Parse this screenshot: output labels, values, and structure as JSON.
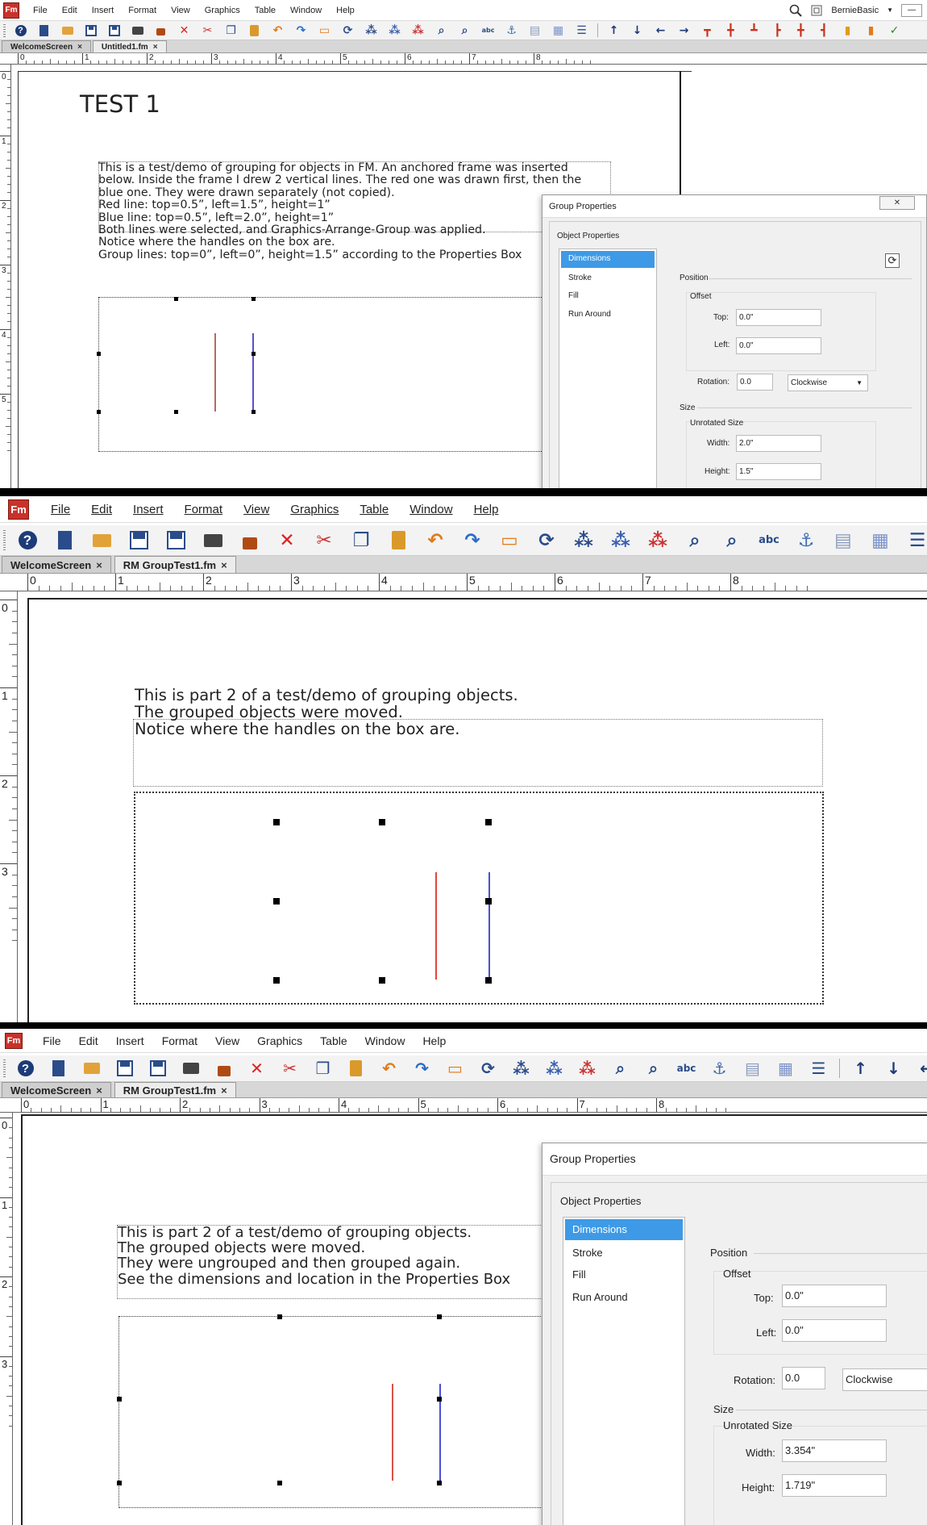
{
  "menu": {
    "logo": "Fm",
    "items": [
      "File",
      "Edit",
      "Insert",
      "Format",
      "View",
      "Graphics",
      "Table",
      "Window",
      "Help"
    ],
    "user": "BernieBasic"
  },
  "toolbar_icons": [
    "help-icon",
    "new-doc-icon",
    "open-icon",
    "save-icon",
    "save-all-icon",
    "print-icon",
    "lock-icon",
    "delete-icon",
    "cut-icon",
    "copy-icon",
    "paste-icon",
    "undo-icon",
    "redo-icon",
    "frame-icon",
    "rotate-icon",
    "group-icon",
    "ungroup-icon",
    "object-icon",
    "zoom-in-icon",
    "zoom-out-icon",
    "spelling-icon",
    "anchor-icon",
    "insert-frame-icon",
    "insert-table-icon",
    "properties-icon",
    "up-arrow-icon",
    "down-arrow-icon",
    "left-arrow-icon",
    "right-arrow-icon",
    "align-top-icon",
    "align-middle-icon",
    "align-bottom-icon",
    "align-left-icon",
    "align-center-icon",
    "align-right-icon",
    "front-icon",
    "back-icon",
    "check-icon"
  ],
  "panel1": {
    "tabs": [
      "WelcomeScreen",
      "Untitled1.fm"
    ],
    "ruler_h": [
      "0",
      "1",
      "2",
      "3",
      "4",
      "5",
      "6",
      "7",
      "8"
    ],
    "ruler_v": [
      "0",
      "1",
      "2",
      "3",
      "4",
      "5"
    ],
    "heading": "TEST 1",
    "lines": [
      "This is a test/demo of grouping for objects in FM. An anchored frame was inserted",
      "below. Inside the frame I drew 2 vertical lines. The red one was drawn first, then the",
      "blue one. They were drawn separately (not copied).",
      "Red line: top=0.5”, left=1.5”, height=1”",
      "Blue line: top=0.5”, left=2.0”, height=1”",
      "Both lines were selected, and Graphics-Arrange-Group was applied.",
      "Notice where the handles on the box are.",
      "Group lines: top=0”, left=0”, height=1.5”    according to the Properties Box"
    ],
    "dialog": {
      "title": "Group Properties",
      "close": "✕",
      "section": "Object Properties",
      "list": [
        "Dimensions",
        "Stroke",
        "Fill",
        "Run Around"
      ],
      "position_label": "Position",
      "offset_label": "Offset",
      "top_label": "Top:",
      "top_value": "0.0\"",
      "left_label": "Left:",
      "left_value": "0.0\"",
      "rotation_label": "Rotation:",
      "rotation_value": "0.0",
      "rotation_dir": "Clockwise",
      "size_label": "Size",
      "unrotated_label": "Unrotated Size",
      "width_label": "Width:",
      "width_value": "2.0\"",
      "height_label": "Height:",
      "height_value": "1.5\""
    }
  },
  "panel2": {
    "tabs": [
      "WelcomeScreen",
      "RM GroupTest1.fm"
    ],
    "ruler_h": [
      "0",
      "1",
      "2",
      "3",
      "4",
      "5",
      "6",
      "7",
      "8"
    ],
    "ruler_v": [
      "0",
      "1",
      "2",
      "3"
    ],
    "lines": [
      "This is part 2 of a test/demo of grouping objects.",
      "The grouped objects were moved.",
      "Notice where the handles on the box are."
    ]
  },
  "panel3": {
    "tabs": [
      "WelcomeScreen",
      "RM GroupTest1.fm"
    ],
    "ruler_h": [
      "0",
      "1",
      "2",
      "3",
      "4",
      "5",
      "6",
      "7",
      "8"
    ],
    "ruler_v": [
      "0",
      "1",
      "2",
      "3"
    ],
    "lines": [
      "This is part 2 of a test/demo of grouping objects.",
      "The grouped objects were moved.",
      "They were ungrouped and then grouped again.",
      "See the dimensions and location in the Properties Box"
    ],
    "dialog": {
      "title": "Group Properties",
      "section": "Object Properties",
      "list": [
        "Dimensions",
        "Stroke",
        "Fill",
        "Run Around"
      ],
      "position_label": "Position",
      "offset_label": "Offset",
      "top_label": "Top:",
      "top_value": "0.0\"",
      "left_label": "Left:",
      "left_value": "0.0\"",
      "rotation_label": "Rotation:",
      "rotation_value": "0.0",
      "rotation_dir": "Clockwise",
      "size_label": "Size",
      "unrotated_label": "Unrotated Size",
      "width_label": "Width:",
      "width_value": "3.354\"",
      "height_label": "Height:",
      "height_value": "1.719\""
    }
  },
  "colors": {
    "red_line": "#d9534a",
    "blue_line": "#4b4fd6",
    "selection": "#3e9ae6",
    "logo": "#c8322b"
  }
}
